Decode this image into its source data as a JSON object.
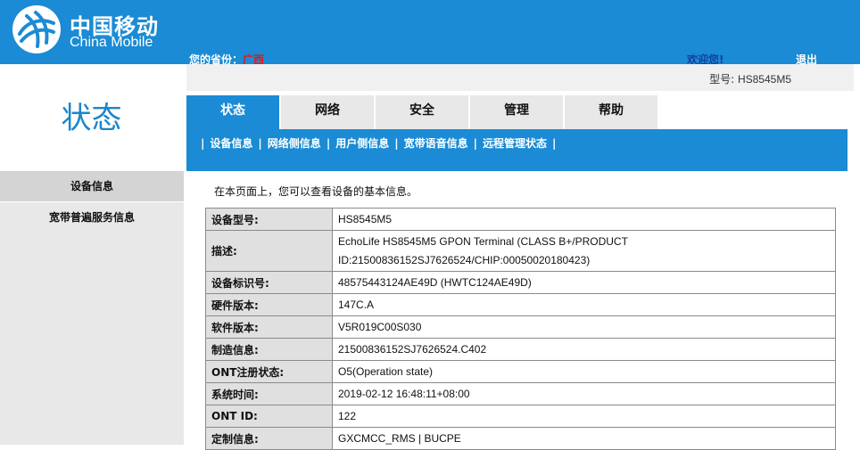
{
  "header": {
    "brand_cn": "中国移动",
    "brand_en": "China Mobile",
    "province_label": "您的省份：",
    "province_value": "广西",
    "welcome": "欢迎您!",
    "logout": "退出",
    "model_label": "型号:",
    "model_value": "HS8545M5"
  },
  "left": {
    "title": "状态",
    "items": [
      {
        "label": "设备信息"
      },
      {
        "label": "宽带普遍服务信息"
      }
    ]
  },
  "tabs": [
    {
      "label": "状态"
    },
    {
      "label": "网络"
    },
    {
      "label": "安全"
    },
    {
      "label": "管理"
    },
    {
      "label": "帮助"
    }
  ],
  "subnav": {
    "separator": "|",
    "items": [
      {
        "label": "设备信息"
      },
      {
        "label": "网络侧信息"
      },
      {
        "label": "用户侧信息"
      },
      {
        "label": "宽带语音信息"
      },
      {
        "label": "远程管理状态"
      }
    ]
  },
  "content": {
    "description": "在本页面上，您可以查看设备的基本信息。",
    "rows": [
      {
        "key": "设备型号:",
        "value": "HS8545M5"
      },
      {
        "key": "描述:",
        "value": "EchoLife HS8545M5 GPON Terminal (CLASS B+/PRODUCT ID:21500836152SJ7626524/CHIP:00050020180423)"
      },
      {
        "key": "设备标识号:",
        "value": "48575443124AE49D (HWTC124AE49D)"
      },
      {
        "key": "硬件版本:",
        "value": "147C.A"
      },
      {
        "key": "软件版本:",
        "value": "V5R019C00S030"
      },
      {
        "key": "制造信息:",
        "value": "21500836152SJ7626524.C402"
      },
      {
        "key": "ONT注册状态:",
        "value": "O5(Operation state)"
      },
      {
        "key": "系统时间:",
        "value": "2019-02-12 16:48:11+08:00"
      },
      {
        "key": "ONT ID:",
        "value": "122"
      },
      {
        "key": "定制信息:",
        "value": "GXCMCC_RMS | BUCPE"
      }
    ]
  },
  "colors": {
    "brand_blue": "#1a8bd4",
    "title_blue": "#1a86c8",
    "province_red": "#e01818"
  },
  "icons": {
    "logo": "china-mobile-logo-icon"
  }
}
